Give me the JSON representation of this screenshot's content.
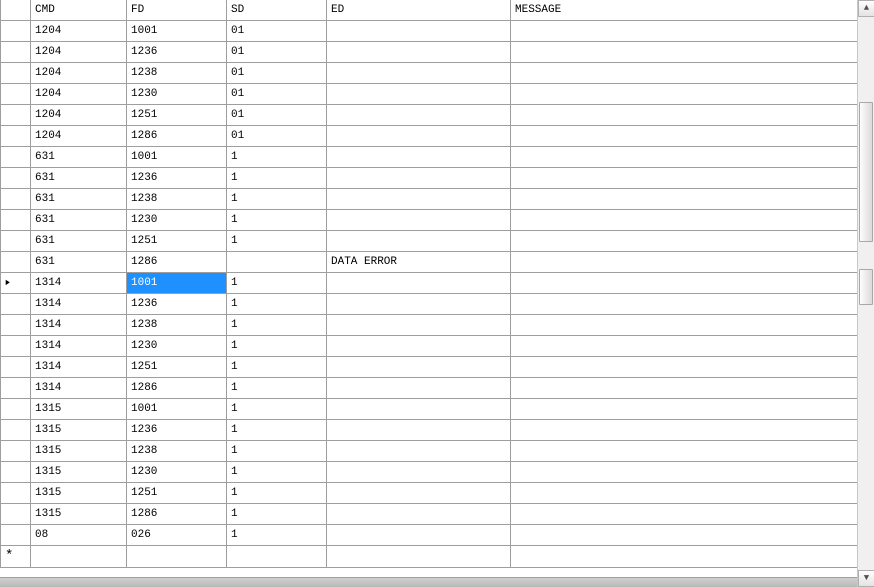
{
  "columns": {
    "cmd": "CMD",
    "fd": "FD",
    "sd": "SD",
    "ed": "ED",
    "msg": "MESSAGE"
  },
  "selectedRow": 12,
  "selectedCol": "fd",
  "rows": [
    {
      "cmd": "1204",
      "fd": "1001",
      "sd": "01",
      "ed": "",
      "msg": ""
    },
    {
      "cmd": "1204",
      "fd": "1236",
      "sd": "01",
      "ed": "",
      "msg": ""
    },
    {
      "cmd": "1204",
      "fd": "1238",
      "sd": "01",
      "ed": "",
      "msg": ""
    },
    {
      "cmd": "1204",
      "fd": "1230",
      "sd": "01",
      "ed": "",
      "msg": ""
    },
    {
      "cmd": "1204",
      "fd": "1251",
      "sd": "01",
      "ed": "",
      "msg": ""
    },
    {
      "cmd": "1204",
      "fd": "1286",
      "sd": "01",
      "ed": "",
      "msg": ""
    },
    {
      "cmd": "631",
      "fd": "1001",
      "sd": "1",
      "ed": "",
      "msg": ""
    },
    {
      "cmd": "631",
      "fd": "1236",
      "sd": "1",
      "ed": "",
      "msg": ""
    },
    {
      "cmd": "631",
      "fd": "1238",
      "sd": "1",
      "ed": "",
      "msg": ""
    },
    {
      "cmd": "631",
      "fd": "1230",
      "sd": "1",
      "ed": "",
      "msg": ""
    },
    {
      "cmd": "631",
      "fd": "1251",
      "sd": "1",
      "ed": "",
      "msg": ""
    },
    {
      "cmd": "631",
      "fd": "1286",
      "sd": "",
      "ed": "DATA ERROR",
      "msg": ""
    },
    {
      "cmd": "1314",
      "fd": "1001",
      "sd": "1",
      "ed": "",
      "msg": ""
    },
    {
      "cmd": "1314",
      "fd": "1236",
      "sd": "1",
      "ed": "",
      "msg": ""
    },
    {
      "cmd": "1314",
      "fd": "1238",
      "sd": "1",
      "ed": "",
      "msg": ""
    },
    {
      "cmd": "1314",
      "fd": "1230",
      "sd": "1",
      "ed": "",
      "msg": ""
    },
    {
      "cmd": "1314",
      "fd": "1251",
      "sd": "1",
      "ed": "",
      "msg": ""
    },
    {
      "cmd": "1314",
      "fd": "1286",
      "sd": "1",
      "ed": "",
      "msg": ""
    },
    {
      "cmd": "1315",
      "fd": "1001",
      "sd": "1",
      "ed": "",
      "msg": ""
    },
    {
      "cmd": "1315",
      "fd": "1236",
      "sd": "1",
      "ed": "",
      "msg": ""
    },
    {
      "cmd": "1315",
      "fd": "1238",
      "sd": "1",
      "ed": "",
      "msg": ""
    },
    {
      "cmd": "1315",
      "fd": "1230",
      "sd": "1",
      "ed": "",
      "msg": ""
    },
    {
      "cmd": "1315",
      "fd": "1251",
      "sd": "1",
      "ed": "",
      "msg": ""
    },
    {
      "cmd": "1315",
      "fd": "1286",
      "sd": "1",
      "ed": "",
      "msg": ""
    },
    {
      "cmd": "08",
      "fd": "026",
      "sd": "1",
      "ed": "",
      "msg": ""
    }
  ]
}
